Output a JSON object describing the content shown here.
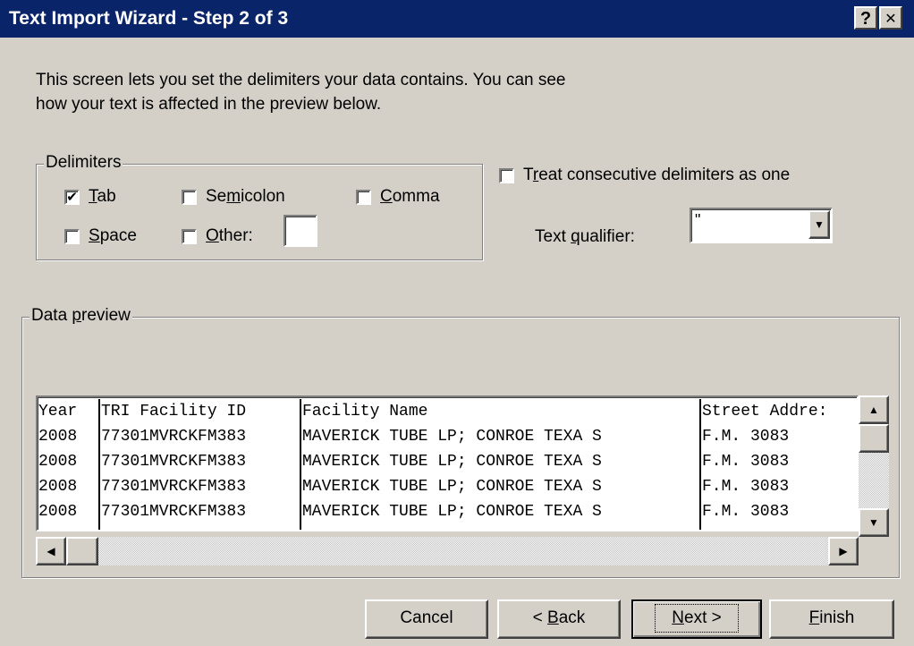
{
  "window": {
    "title": "Text Import Wizard - Step 2 of 3",
    "help_label": "?",
    "close_label": "✕"
  },
  "description": {
    "line1": "This screen lets you set the delimiters your data contains.  You can see",
    "line2": "how your text is affected in the preview below."
  },
  "delimiters": {
    "legend": "Delimiters",
    "tab": {
      "label": "Tab",
      "checked": true
    },
    "semicolon": {
      "label": "Semicolon",
      "checked": false
    },
    "comma": {
      "label": "Comma",
      "checked": false
    },
    "space": {
      "label": "Space",
      "checked": false
    },
    "other": {
      "label": "Other:",
      "checked": false,
      "value": ""
    }
  },
  "consecutive": {
    "label": "Treat consecutive delimiters as one",
    "checked": false
  },
  "text_qualifier": {
    "label": "Text qualifier:",
    "value": "\""
  },
  "preview": {
    "legend": "Data preview",
    "columns": [
      {
        "header": "Year",
        "cells": [
          "2008",
          "2008",
          "2008",
          "2008"
        ]
      },
      {
        "header": "TRI Facility ID",
        "cells": [
          "77301MVRCKFM383",
          "77301MVRCKFM383",
          "77301MVRCKFM383",
          "77301MVRCKFM383"
        ]
      },
      {
        "header": "Facility Name",
        "cells": [
          "MAVERICK TUBE LP; CONROE TEXA S",
          "MAVERICK TUBE LP; CONROE TEXA S",
          "MAVERICK TUBE LP; CONROE TEXA S",
          "MAVERICK TUBE LP; CONROE TEXA S"
        ]
      },
      {
        "header": "Street Addre:",
        "cells": [
          "F.M. 3083",
          "F.M. 3083",
          "F.M. 3083",
          "F.M. 3083"
        ]
      }
    ]
  },
  "buttons": {
    "cancel": "Cancel",
    "back": "< Back",
    "next": "Next >",
    "finish": "Finish"
  }
}
